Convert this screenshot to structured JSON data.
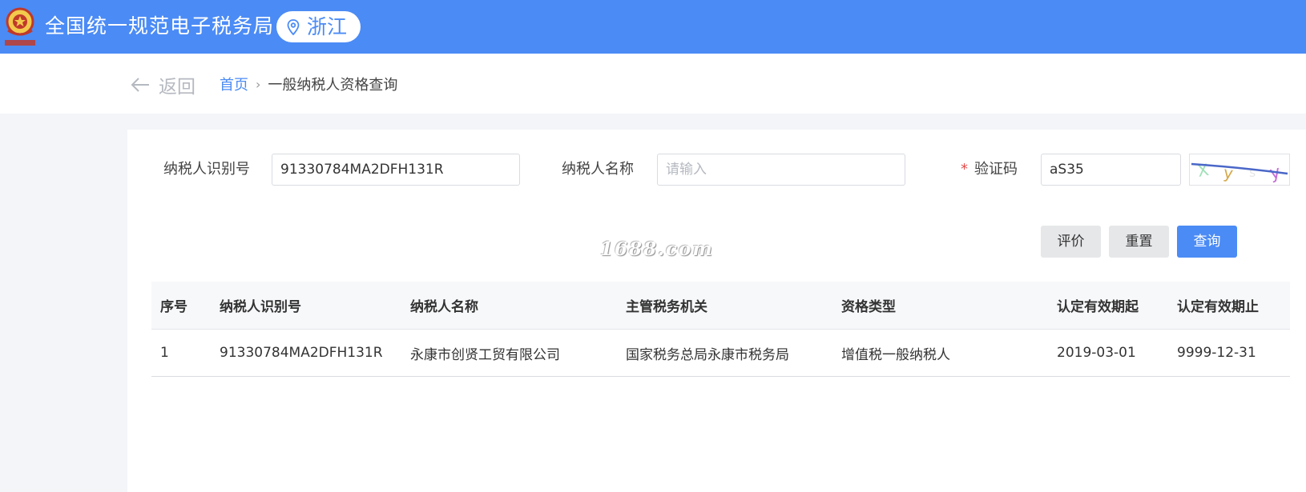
{
  "header": {
    "site_title": "全国统一规范电子税务局",
    "region": "浙江",
    "brand_color": "#4b8bf5"
  },
  "nav": {
    "back_label": "返回",
    "breadcrumb_home": "首页",
    "breadcrumb_separator": "›",
    "breadcrumb_current": "一般纳税人资格查询"
  },
  "form": {
    "taxpayer_id_label": "纳税人识别号",
    "taxpayer_id_value": "91330784MA2DFH131R",
    "taxpayer_name_label": "纳税人名称",
    "taxpayer_name_placeholder": "请输入",
    "captcha_required_mark": "*",
    "captcha_label": "验证码",
    "captcha_value": "aS35"
  },
  "buttons": {
    "evaluate": "评价",
    "reset": "重置",
    "query": "查询"
  },
  "watermark": "1688.com",
  "table": {
    "headers": [
      "序号",
      "纳税人识别号",
      "纳税人名称",
      "主管税务机关",
      "资格类型",
      "认定有效期起",
      "认定有效期止"
    ],
    "rows": [
      [
        "1",
        "91330784MA2DFH131R",
        "永康市创贤工贸有限公司",
        "国家税务总局永康市税务局",
        "增值税一般纳税人",
        "2019-03-01",
        "9999-12-31"
      ]
    ]
  }
}
